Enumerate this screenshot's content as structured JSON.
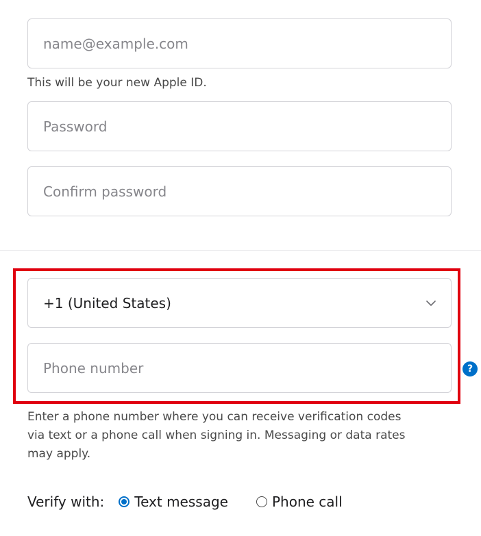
{
  "email": {
    "placeholder": "name@example.com",
    "helper": "This will be your new Apple ID."
  },
  "password": {
    "placeholder": "Password"
  },
  "confirm_password": {
    "placeholder": "Confirm password"
  },
  "country_code": {
    "selected": "+1 (United States)",
    "icon": "chevron-down-icon"
  },
  "phone": {
    "placeholder": "Phone number",
    "help_glyph": "?",
    "helper_lines": [
      "Enter a phone number where you can receive verification codes",
      "via text or a phone call when signing in. Messaging or data rates",
      "may apply."
    ]
  },
  "verify": {
    "label": "Verify with:",
    "options": [
      {
        "label": "Text message",
        "checked": true
      },
      {
        "label": "Phone call",
        "checked": false
      }
    ]
  },
  "colors": {
    "accent": "#0070c9",
    "highlight": "#e0000f",
    "border": "#d2d2d7"
  }
}
